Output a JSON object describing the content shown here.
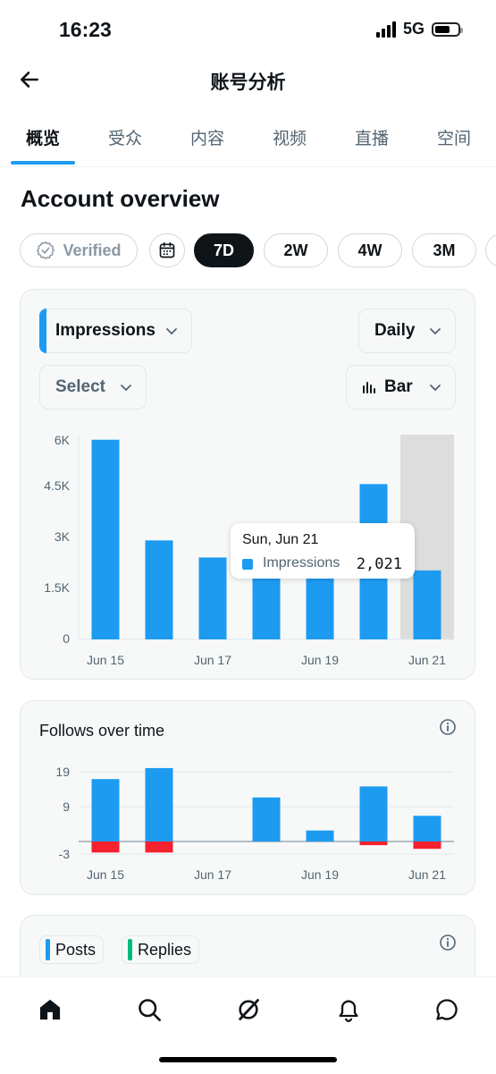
{
  "status": {
    "time": "16:23",
    "network": "5G"
  },
  "header": {
    "title": "账号分析"
  },
  "tabs": [
    {
      "label": "概览",
      "active": true
    },
    {
      "label": "受众",
      "active": false
    },
    {
      "label": "内容",
      "active": false
    },
    {
      "label": "视频",
      "active": false
    },
    {
      "label": "直播",
      "active": false
    },
    {
      "label": "空间",
      "active": false
    }
  ],
  "overview": {
    "title": "Account overview"
  },
  "filters": {
    "verified_label": "Verified",
    "ranges": [
      {
        "label": "7D",
        "selected": true
      },
      {
        "label": "2W",
        "selected": false
      },
      {
        "label": "4W",
        "selected": false
      },
      {
        "label": "3M",
        "selected": false
      }
    ]
  },
  "impressions_card": {
    "metric_label": "Impressions",
    "interval_label": "Daily",
    "compare_label": "Select",
    "chart_type_label": "Bar",
    "tooltip": {
      "title": "Sun, Jun 21",
      "series": "Impressions",
      "value": "2,021"
    }
  },
  "follows_card": {
    "title": "Follows over time"
  },
  "posts_card": {
    "legend": [
      "Posts",
      "Replies"
    ]
  },
  "colors": {
    "accent": "#1d9bf0",
    "negative": "#f4212e",
    "replies": "#00ba7c",
    "dark": "#0f1419"
  },
  "icons": {
    "back": "arrow-left-icon",
    "calendar": "calendar-icon",
    "verified": "verified-badge-icon",
    "bar_chart": "bar-chart-icon",
    "info": "info-icon"
  },
  "nav": [
    "home-icon",
    "search-icon",
    "grok-icon",
    "notifications-icon",
    "messages-icon"
  ],
  "chart_data": [
    {
      "type": "bar",
      "title": "",
      "categories": [
        "Jun 15",
        "Jun 16",
        "Jun 17",
        "Jun 18",
        "Jun 19",
        "Jun 20",
        "Jun 21"
      ],
      "tick_labels_x": [
        "Jun 15",
        "Jun 17",
        "Jun 19",
        "Jun 21"
      ],
      "tick_labels_y": [
        "0",
        "1.5K",
        "3K",
        "4.5K",
        "6K"
      ],
      "series": [
        {
          "name": "Impressions",
          "values": [
            5850,
            2900,
            2400,
            2050,
            2300,
            4550,
            2021
          ]
        }
      ],
      "ylim": [
        0,
        6000
      ],
      "highlighted_category": "Jun 21",
      "grid": false
    },
    {
      "type": "bar",
      "title": "Follows over time",
      "categories": [
        "Jun 15",
        "Jun 16",
        "Jun 17",
        "Jun 18",
        "Jun 19",
        "Jun 20",
        "Jun 21"
      ],
      "tick_labels_x": [
        "Jun 15",
        "Jun 17",
        "Jun 19",
        "Jun 21"
      ],
      "tick_labels_y": [
        "-3",
        "9",
        "19"
      ],
      "series": [
        {
          "values": [
            17,
            20,
            0,
            12,
            3,
            15,
            7
          ]
        },
        {
          "values": [
            -3,
            -3,
            0,
            0,
            0,
            -1,
            -2
          ]
        }
      ],
      "ylim": [
        -3,
        19
      ],
      "grid": true
    }
  ]
}
